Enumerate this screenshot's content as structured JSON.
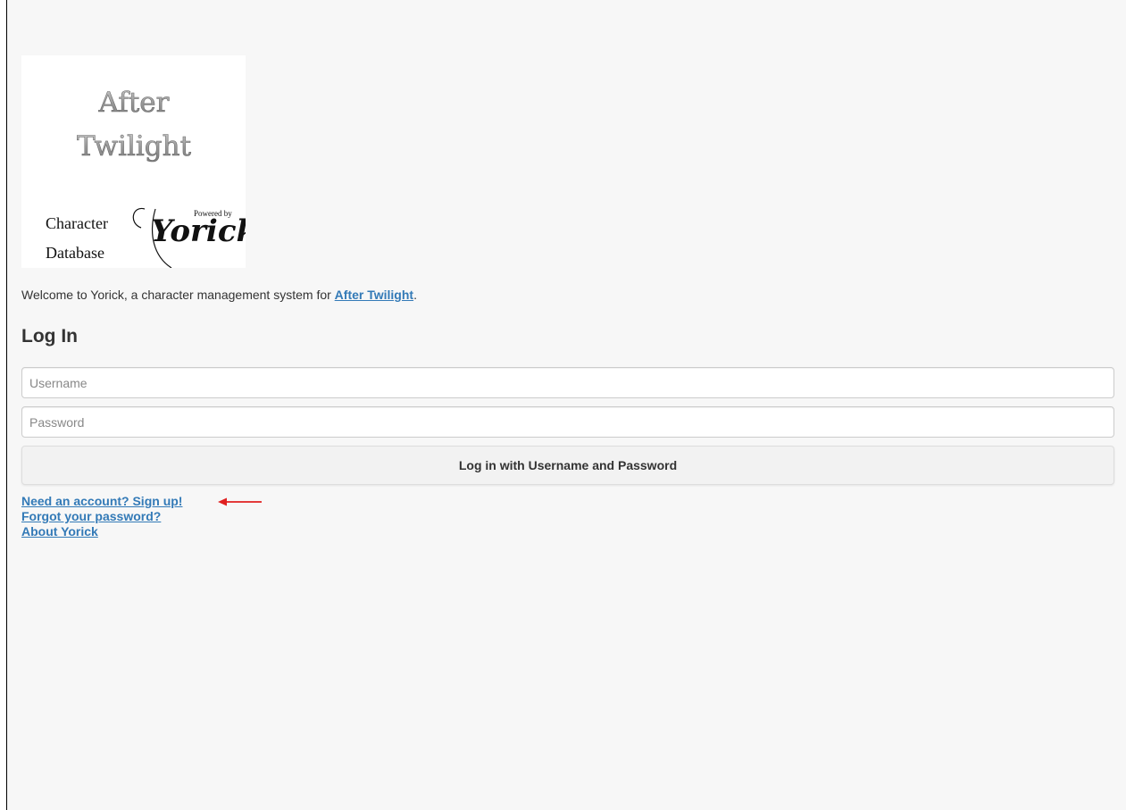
{
  "logo": {
    "line1": "After",
    "line2": "Twilight",
    "character": "Character",
    "database": "Database",
    "powered_by": "Powered by",
    "brand": "Yorick"
  },
  "intro": {
    "prefix": "Welcome to Yorick, a character management system for ",
    "link_text": "After Twilight",
    "suffix": "."
  },
  "login": {
    "heading": "Log In",
    "username_placeholder": "Username",
    "password_placeholder": "Password",
    "submit_label": "Log in with Username and Password"
  },
  "links": {
    "signup": "Need an account? Sign up!",
    "forgot": "Forgot your password?",
    "about": "About Yorick"
  },
  "colors": {
    "link": "#337ab7",
    "annotation_arrow": "#e02020",
    "background": "#f7f7f7"
  },
  "icons": {
    "annotation": "left-arrow-icon"
  }
}
